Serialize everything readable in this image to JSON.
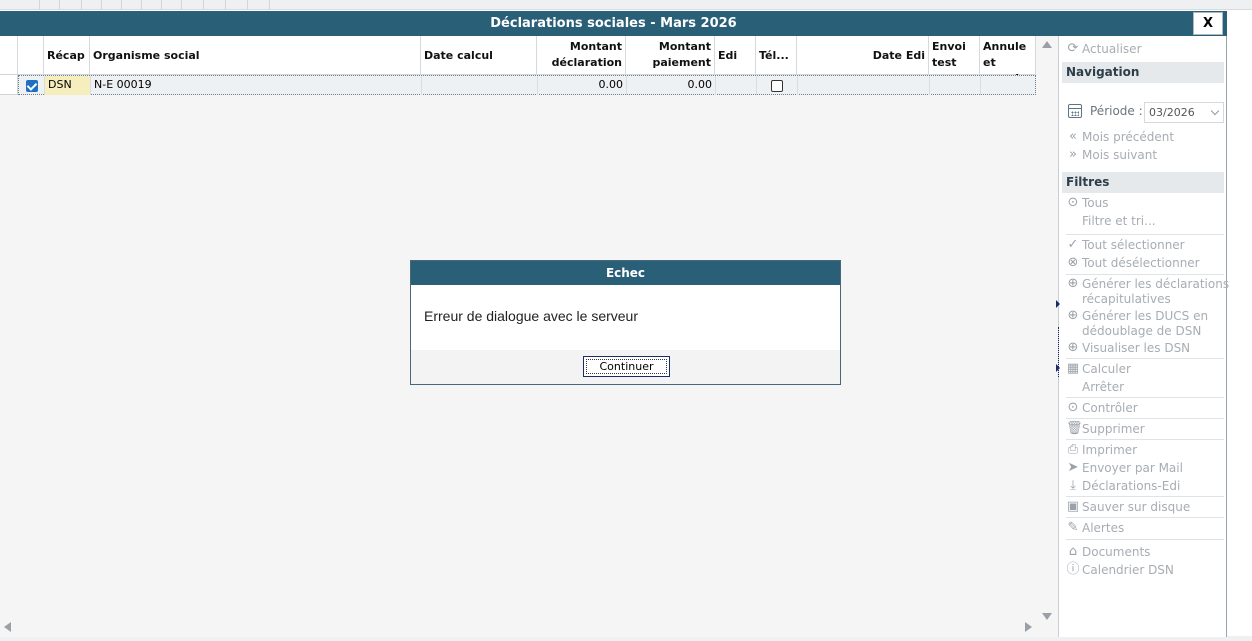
{
  "window": {
    "title": "Déclarations sociales - Mars 2026",
    "close_label": "X"
  },
  "grid": {
    "columns": [
      {
        "label": ""
      },
      {
        "label": "Récap"
      },
      {
        "label": "Organisme social"
      },
      {
        "label": "Date calcul"
      },
      {
        "label": "Montant déclaration"
      },
      {
        "label": "Montant paiement"
      },
      {
        "label": "Edi"
      },
      {
        "label": "Tél..."
      },
      {
        "label": "Date Edi"
      },
      {
        "label": "Envoi test"
      },
      {
        "label": "Annule et rempla..."
      }
    ],
    "rows": [
      {
        "selected": true,
        "recap": "DSN",
        "organisme": "N-E  00019",
        "date_calcul": "",
        "montant_declaration": "0.00",
        "montant_paiement": "0.00",
        "edi": "",
        "tele_checked": false,
        "date_edi": "",
        "envoi_test": "",
        "annule": ""
      }
    ]
  },
  "dialog": {
    "title": "Echec",
    "message": "Erreur de dialogue avec le serveur",
    "button_label": "Continuer"
  },
  "panel": {
    "actualiser": "Actualiser",
    "navigation_title": "Navigation",
    "periode_label": "Période :",
    "periode_value": "03/2026",
    "mois_precedent": "Mois précédent",
    "mois_suivant": "Mois suivant",
    "filtres_title": "Filtres",
    "tous": "Tous",
    "filtre_tri": "Filtre et tri...",
    "tout_selectionner": "Tout sélectionner",
    "tout_deselectionner": "Tout désélectionner",
    "generer_recap_1": "Générer les déclarations",
    "generer_recap_2": "récapitulatives",
    "generer_ducs_1": "Générer les DUCS en",
    "generer_ducs_2": "dédoublage de DSN",
    "visualiser_dsn": "Visualiser les DSN",
    "calculer": "Calculer",
    "arreter": "Arrêter",
    "controler": "Contrôler",
    "supprimer": "Supprimer",
    "imprimer": "Imprimer",
    "envoyer_mail": "Envoyer par Mail",
    "declarations_edi": "Déclarations-Edi",
    "sauver_disque": "Sauver sur disque",
    "alertes": "Alertes",
    "documents": "Documents",
    "calendrier_dsn": "Calendrier DSN"
  }
}
